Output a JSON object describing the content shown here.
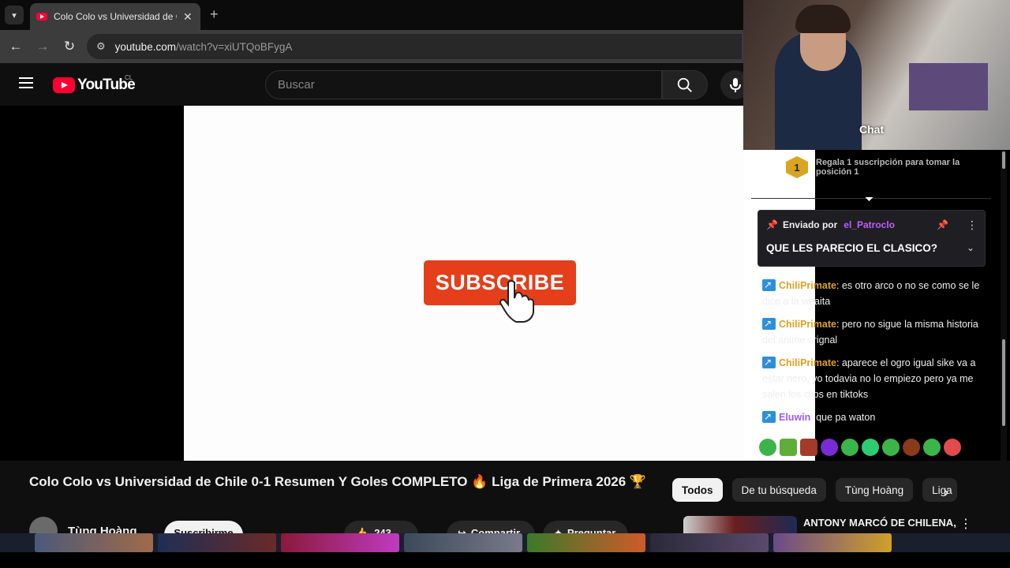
{
  "browser": {
    "tab_title": "Colo Colo vs Universidad de Chile 0-1 Resumen",
    "tab_close": "✕",
    "new_tab": "+",
    "url_host": "youtube.com",
    "url_path": "/watch?v=xiUTQoBFygA"
  },
  "youtube": {
    "country_code": "CL",
    "logo_text": "YouTube",
    "search_placeholder": "Buscar",
    "video_overlay_text": "SUBSCRIBE",
    "video_title": "Colo Colo vs Universidad de Chile 0-1 Resumen Y Goles COMPLETO 🔥 Liga de Primera 2026 🏆",
    "channel_name": "Tùng Hoàng",
    "subscribe_label": "Suscribirme",
    "like_count": "243",
    "share_label": "Compartir",
    "ask_label": "Preguntar",
    "chips": [
      "Todos",
      "De tu búsqueda",
      "Tùng Hoàng",
      "Liga"
    ],
    "rec_title": "ANTONY MARCÓ DE CHILENA,"
  },
  "stream": {
    "chat_label": "Chat",
    "gift_rank": "1",
    "gift_text": "Regala 1 suscripción para tomar la posición 1",
    "pinned_by_label": "Enviado por",
    "pinned_user": "el_Patroclo",
    "pinned_message": "QUE LES PARECIO EL CLASICO?",
    "messages": [
      {
        "user": "ChiliPrimate",
        "text": ": es otro arco o no se como se le dice a la weaita",
        "color": "#e0a020"
      },
      {
        "user": "ChiliPrimate",
        "text": ": pero no sigue la misma historia del anime orignal",
        "color": "#e0a020"
      },
      {
        "user": "ChiliPrimate",
        "text": ": aparece el ogro igual sike va a estar nero, yo todavia no lo empiezo pero ya me salen los clips en tiktoks",
        "color": "#e0a020"
      },
      {
        "user": "Eluwin",
        "text": ": que pa waton",
        "color": "#9b59ff"
      }
    ]
  },
  "colors": {
    "youtube_red": "#ff0033",
    "subscribe_orange": "#e53e1a",
    "pinned_user": "#bf5cff"
  }
}
